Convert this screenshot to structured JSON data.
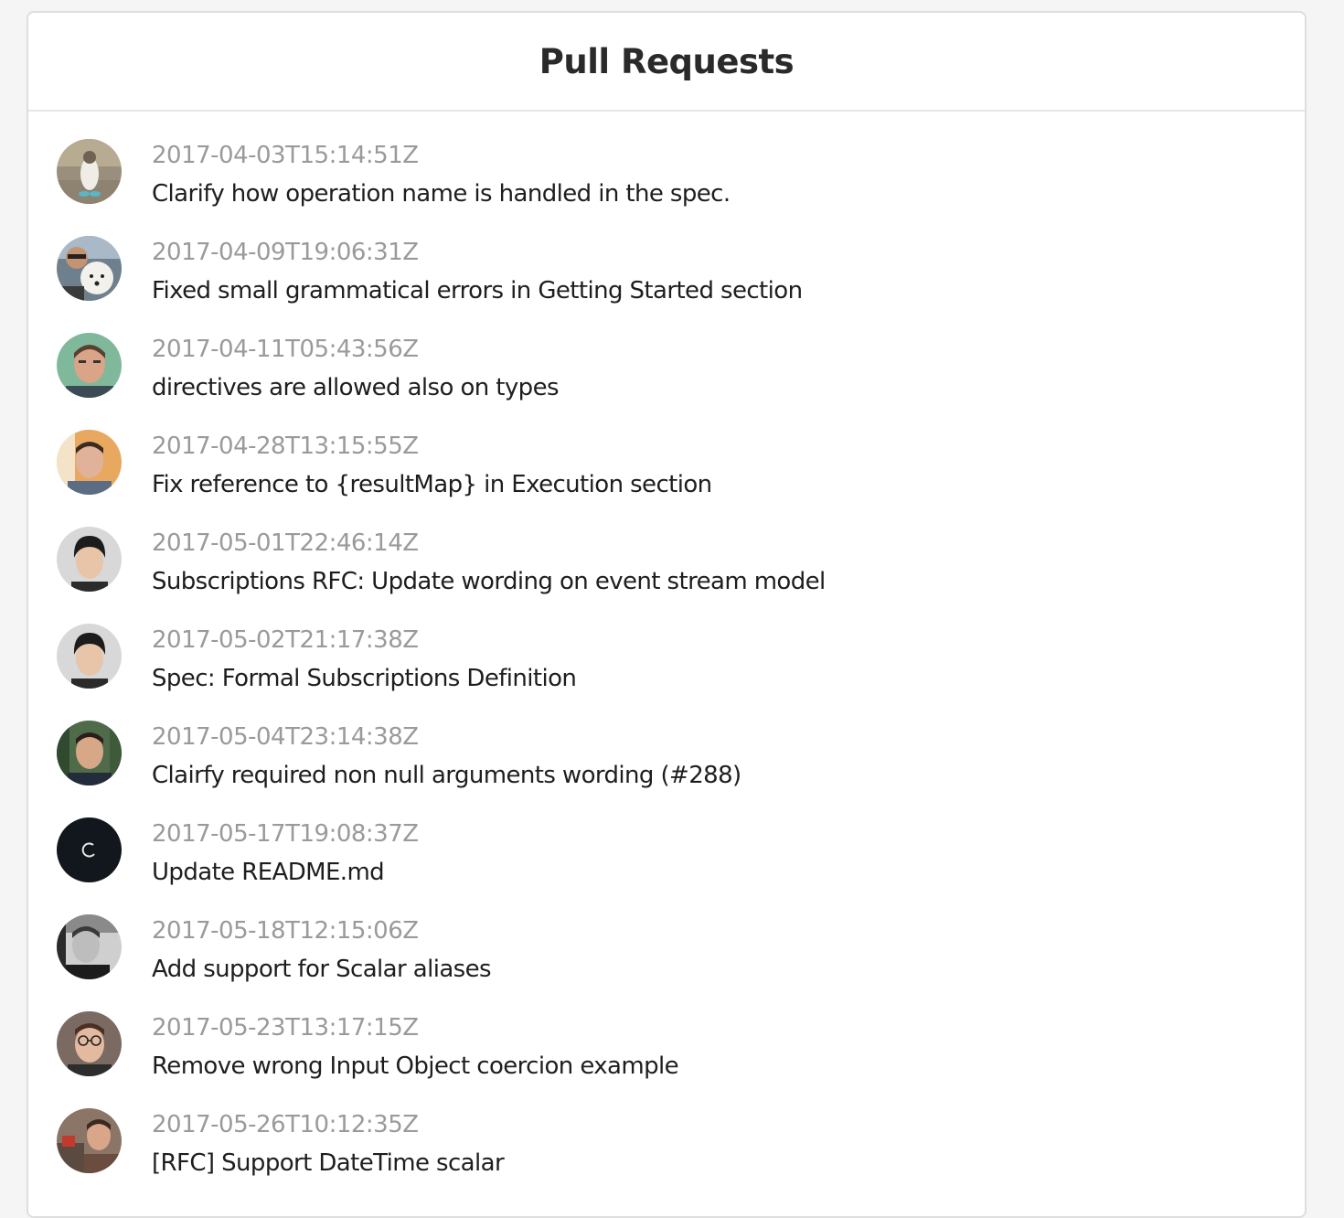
{
  "header": {
    "title": "Pull Requests"
  },
  "pull_requests": [
    {
      "date": "2017-04-03T15:14:51Z",
      "title": "Clarify how operation name is handled in the spec.",
      "avatar": "bird-avatar"
    },
    {
      "date": "2017-04-09T19:06:31Z",
      "title": "Fixed small grammatical errors in Getting Started section",
      "avatar": "man-with-dog-avatar"
    },
    {
      "date": "2017-04-11T05:43:56Z",
      "title": "directives are allowed also on types",
      "avatar": "man-green-bg-avatar"
    },
    {
      "date": "2017-04-28T13:15:55Z",
      "title": "Fix reference to {resultMap} in Execution section",
      "avatar": "man-orange-bg-avatar"
    },
    {
      "date": "2017-05-01T22:46:14Z",
      "title": "Subscriptions RFC: Update wording on event stream model",
      "avatar": "young-man-avatar"
    },
    {
      "date": "2017-05-02T21:17:38Z",
      "title": "Spec: Formal Subscriptions Definition",
      "avatar": "young-man-avatar"
    },
    {
      "date": "2017-05-04T23:14:38Z",
      "title": "Clairfy required non null arguments wording (#288)",
      "avatar": "man-trees-avatar"
    },
    {
      "date": "2017-05-17T19:08:37Z",
      "title": "Update README.md",
      "avatar": "dark-logo-avatar"
    },
    {
      "date": "2017-05-18T12:15:06Z",
      "title": "Add support for Scalar aliases",
      "avatar": "grayscale-man-avatar"
    },
    {
      "date": "2017-05-23T13:17:15Z",
      "title": "Remove wrong Input Object coercion example",
      "avatar": "man-glasses-avatar"
    },
    {
      "date": "2017-05-26T10:12:35Z",
      "title": "[RFC] Support DateTime scalar",
      "avatar": "man-cafe-avatar"
    }
  ]
}
